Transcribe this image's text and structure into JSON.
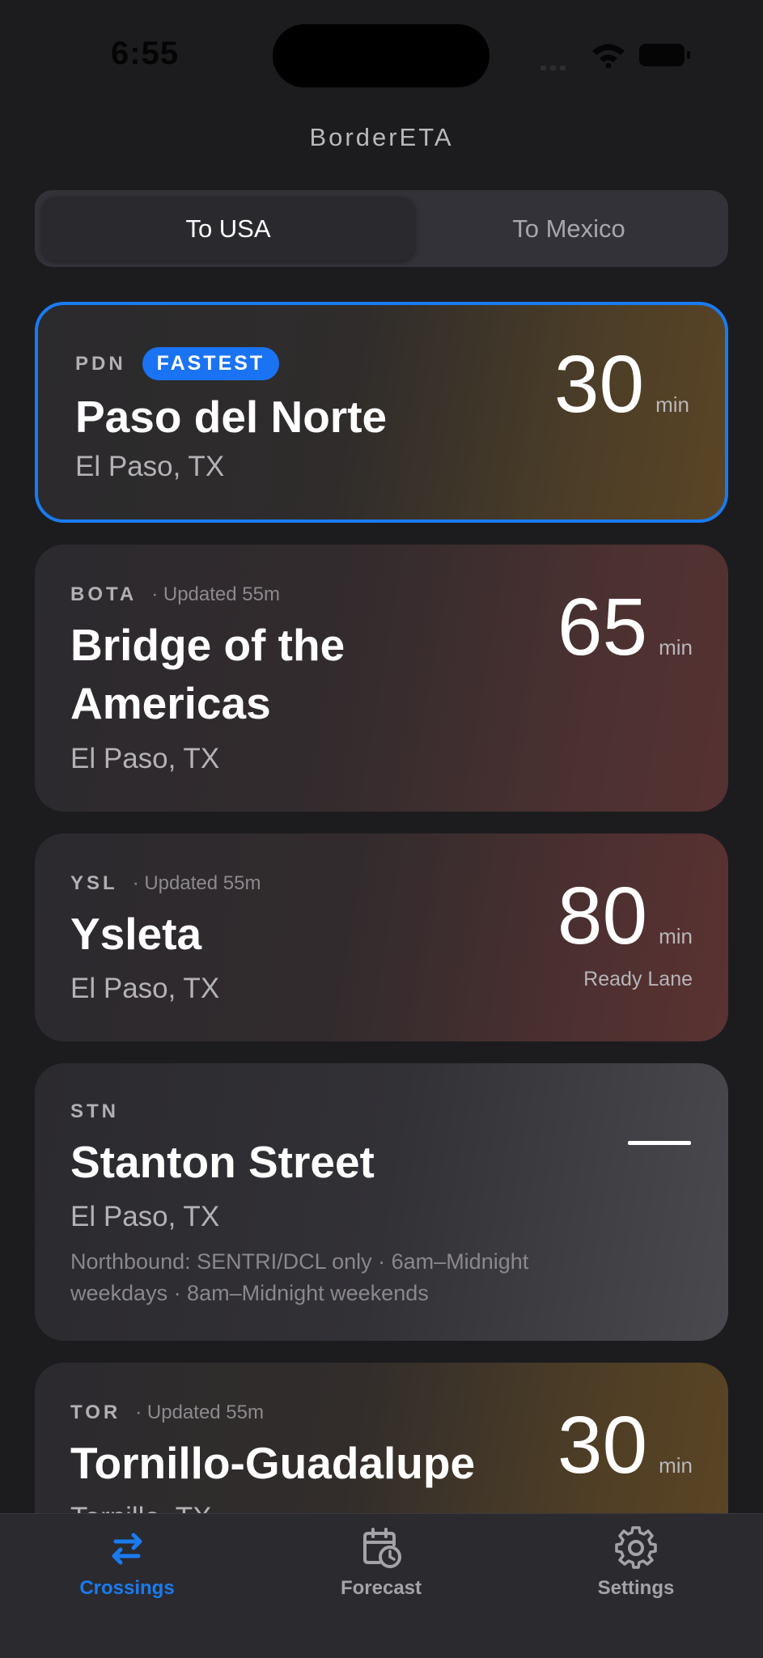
{
  "status_bar": {
    "time": "6:55",
    "icons": [
      "cellular-signal-icon",
      "wifi-icon",
      "battery-icon"
    ]
  },
  "app": {
    "title": "BorderETA"
  },
  "direction": {
    "options": [
      "To USA",
      "To Mexico"
    ],
    "selected": "To USA"
  },
  "colors": {
    "accent": "#1a7bf0",
    "background": "#1c1c1f",
    "card": "#2b2a2e",
    "fast_tint": "#5a4525",
    "slow_tint": "#573131"
  },
  "crossings": [
    {
      "code": "PDN",
      "badge": "FASTEST",
      "name": "Paso del Norte",
      "city": "El Paso, TX",
      "wait": "30",
      "unit": "min",
      "status": "fast",
      "selected": true
    },
    {
      "code": "BOTA",
      "updated": "· Updated 55m",
      "name_line1": "Bridge of the",
      "name_line2": "Americas",
      "city": "El Paso, TX",
      "wait": "65",
      "unit": "min",
      "status": "slow"
    },
    {
      "code": "YSL",
      "updated": "· Updated 55m",
      "name": "Ysleta",
      "city": "El Paso, TX",
      "wait": "80",
      "unit": "min",
      "lane": "Ready Lane",
      "status": "slow"
    },
    {
      "code": "STN",
      "name": "Stanton Street",
      "city": "El Paso, TX",
      "note_line1": "Northbound: SENTRI/DCL only · 6am–Midnight",
      "note_line2": "weekdays · 8am–Midnight weekends",
      "wait_display": "—",
      "status": "unavailable"
    },
    {
      "code": "TOR",
      "updated": "· Updated 55m",
      "name": "Tornillo-Guadalupe",
      "city": "Tornillo, TX",
      "wait": "30",
      "unit": "min",
      "status": "fast"
    }
  ],
  "tabbar": {
    "tabs": [
      {
        "label": "Crossings",
        "icon": "arrows-swap-icon",
        "active": true
      },
      {
        "label": "Forecast",
        "icon": "calendar-clock-icon",
        "active": false
      },
      {
        "label": "Settings",
        "icon": "gear-icon",
        "active": false
      }
    ]
  }
}
